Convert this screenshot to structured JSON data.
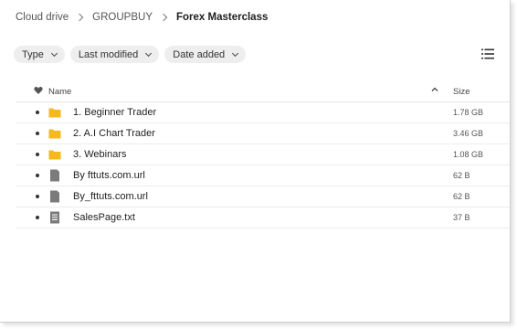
{
  "breadcrumb": [
    "Cloud drive",
    "GROUPBUY",
    "Forex Masterclass"
  ],
  "filters": {
    "type_label": "Type",
    "last_modified_label": "Last modified",
    "date_added_label": "Date added"
  },
  "table": {
    "col_name": "Name",
    "col_size": "Size",
    "rows": [
      {
        "name": "1. Beginner Trader",
        "size": "1.78 GB",
        "icon": "folder-icon"
      },
      {
        "name": "2. A.I Chart Trader",
        "size": "3.46 GB",
        "icon": "folder-icon"
      },
      {
        "name": "3. Webinars",
        "size": "1.08 GB",
        "icon": "folder-icon"
      },
      {
        "name": "By fttuts.com.url",
        "size": "62 B",
        "icon": "url-file-icon"
      },
      {
        "name": "By_fttuts.com.url",
        "size": "62 B",
        "icon": "url-file-icon"
      },
      {
        "name": "SalesPage.txt",
        "size": "37 B",
        "icon": "text-file-icon"
      }
    ]
  },
  "colors": {
    "folder": "#f5b91c",
    "file": "#7b7b7b",
    "chip_bg": "#eeeeee"
  }
}
